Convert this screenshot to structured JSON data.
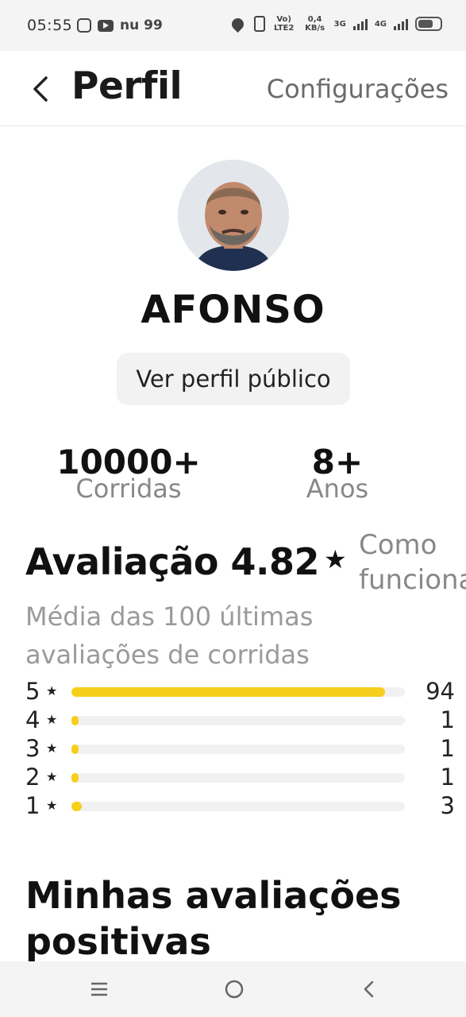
{
  "status_bar": {
    "time": "05:55",
    "carrier_text": "nu 99",
    "network_small_1": "Vo) LTE2",
    "network_small_2": "0,4 KB/s",
    "network_small_3": "3G",
    "network_small_4": "4G",
    "icons": [
      "instagram-icon",
      "youtube-icon",
      "location-icon",
      "vibrate-icon",
      "signal-icon",
      "battery-icon"
    ]
  },
  "header": {
    "title": "Perfil",
    "settings_label": "Configurações"
  },
  "profile": {
    "name": "AFONSO",
    "public_profile_button": "Ver perfil público"
  },
  "stats": {
    "rides_value": "10000+",
    "rides_label": "Corridas",
    "years_value": "8+",
    "years_label": "Anos"
  },
  "rating": {
    "title": "Avaliação 4.82",
    "star": "★",
    "how_it_works": "Como funciona",
    "subtitle": "Média das 100 últimas avaliações de corridas",
    "rows": [
      {
        "stars": "5",
        "count": "94",
        "fraction": 0.94
      },
      {
        "stars": "4",
        "count": "1",
        "fraction": 0.01
      },
      {
        "stars": "3",
        "count": "1",
        "fraction": 0.01
      },
      {
        "stars": "2",
        "count": "1",
        "fraction": 0.01
      },
      {
        "stars": "1",
        "count": "3",
        "fraction": 0.03
      }
    ]
  },
  "positive_reviews": {
    "title": "Minhas avaliações positivas"
  },
  "colors": {
    "accent": "#f6cf1b",
    "muted_text": "#888888",
    "bar_track": "#f1f1f1"
  }
}
